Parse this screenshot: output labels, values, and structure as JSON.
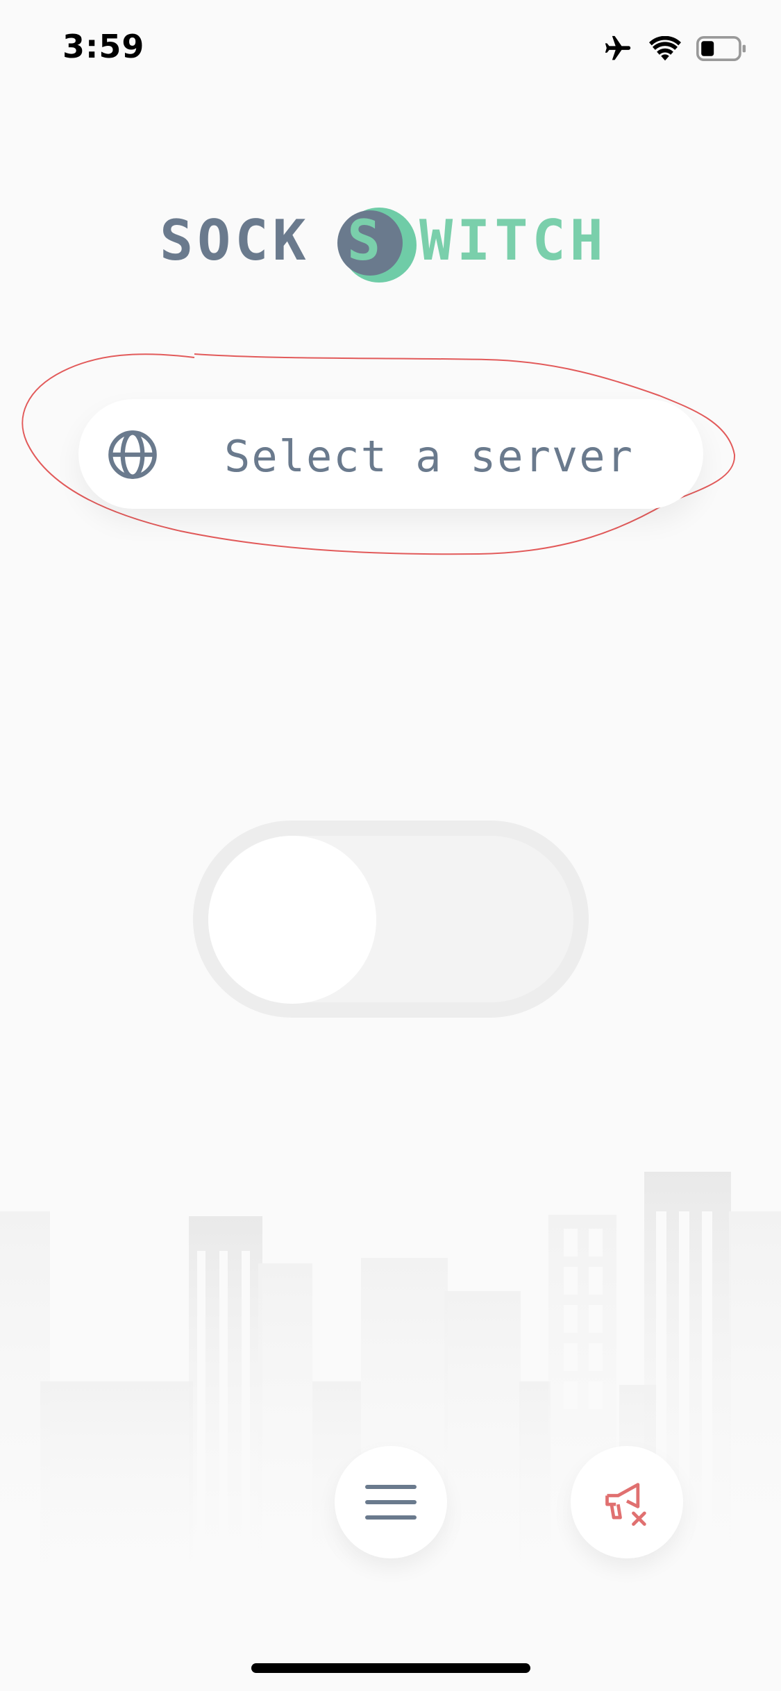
{
  "status_bar": {
    "time": "3:59",
    "icons": [
      "airplane-icon",
      "wifi-icon",
      "battery-icon"
    ]
  },
  "logo": {
    "part1": "SOCK",
    "badge_letter": "S",
    "part2": "WITCH",
    "colors": {
      "slate": "#6a7a8d",
      "mint": "#7acfab"
    }
  },
  "server_selector": {
    "icon": "globe-icon",
    "label": "Select a server"
  },
  "connection_toggle": {
    "state": "off"
  },
  "bottom_bar": {
    "menu_icon": "hamburger-menu-icon",
    "ads_icon": "megaphone-off-icon",
    "ads_icon_color": "#e07070"
  }
}
